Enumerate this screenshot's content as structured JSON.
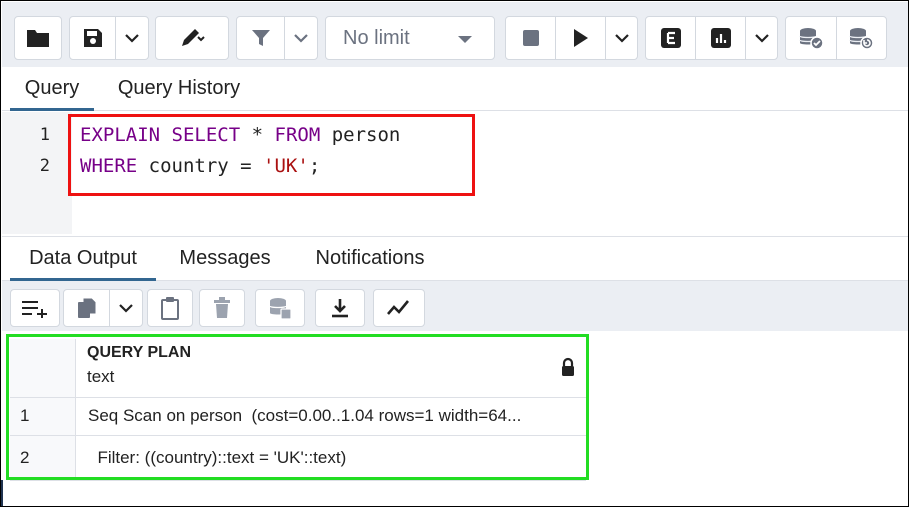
{
  "toolbar": {
    "limit_select": {
      "value": "No limit"
    },
    "buttons": [
      {
        "name": "open-file-button",
        "icon": "folder-icon"
      },
      {
        "name": "save-file-button",
        "icon": "floppy-disk-icon"
      },
      {
        "name": "save-dropdown-button",
        "icon": "chevron-down-icon"
      },
      {
        "name": "edit-button",
        "icon": "pencil-icon"
      },
      {
        "name": "filter-button",
        "icon": "funnel-icon"
      },
      {
        "name": "stop-button",
        "icon": "stop-square-icon"
      },
      {
        "name": "execute-button",
        "icon": "play-icon"
      },
      {
        "name": "explain-button",
        "icon": "explain-e-icon"
      },
      {
        "name": "explain-analyze-button",
        "icon": "bar-chart-icon"
      },
      {
        "name": "commit-button",
        "icon": "database-check-icon"
      },
      {
        "name": "rollback-button",
        "icon": "database-undo-icon"
      }
    ],
    "colors": {
      "toolbar_bg": "#ebeef3",
      "icon": "#222222"
    }
  },
  "editor_tabs": {
    "query": "Query",
    "history": "Query History"
  },
  "editor": {
    "lines": [
      {
        "number": "1",
        "tokens": [
          "EXPLAIN",
          " ",
          "SELECT",
          " * ",
          "FROM",
          " person"
        ]
      },
      {
        "number": "2",
        "tokens": [
          "WHERE",
          " country = ",
          "'UK'",
          ";"
        ]
      }
    ],
    "colors": {
      "keyword": "#770088",
      "string": "#aa1111"
    }
  },
  "output_tabs": {
    "data_output": "Data Output",
    "messages": "Messages",
    "notifications": "Notifications"
  },
  "output_toolbar": {
    "buttons": [
      {
        "name": "add-row-button",
        "icon": "add-row-icon"
      },
      {
        "name": "copy-button",
        "icon": "copy-icon"
      },
      {
        "name": "copy-dropdown-button",
        "icon": "chevron-down-icon"
      },
      {
        "name": "paste-button",
        "icon": "clipboard-icon"
      },
      {
        "name": "delete-button",
        "icon": "trash-icon"
      },
      {
        "name": "save-data-button",
        "icon": "database-save-icon"
      },
      {
        "name": "download-button",
        "icon": "download-icon"
      },
      {
        "name": "graph-button",
        "icon": "line-graph-icon"
      }
    ]
  },
  "results": {
    "column": {
      "name": "QUERY PLAN",
      "type": "text",
      "lock_icon": "lock-icon"
    },
    "rows": [
      {
        "num": "1",
        "value": "Seq Scan on person  (cost=0.00..1.04 rows=1 width=64..."
      },
      {
        "num": "2",
        "value": "  Filter: ((country)::text = 'UK'::text)"
      }
    ]
  },
  "highlights": {
    "editor_box": "#ee1111",
    "results_box": "#22dd22"
  }
}
